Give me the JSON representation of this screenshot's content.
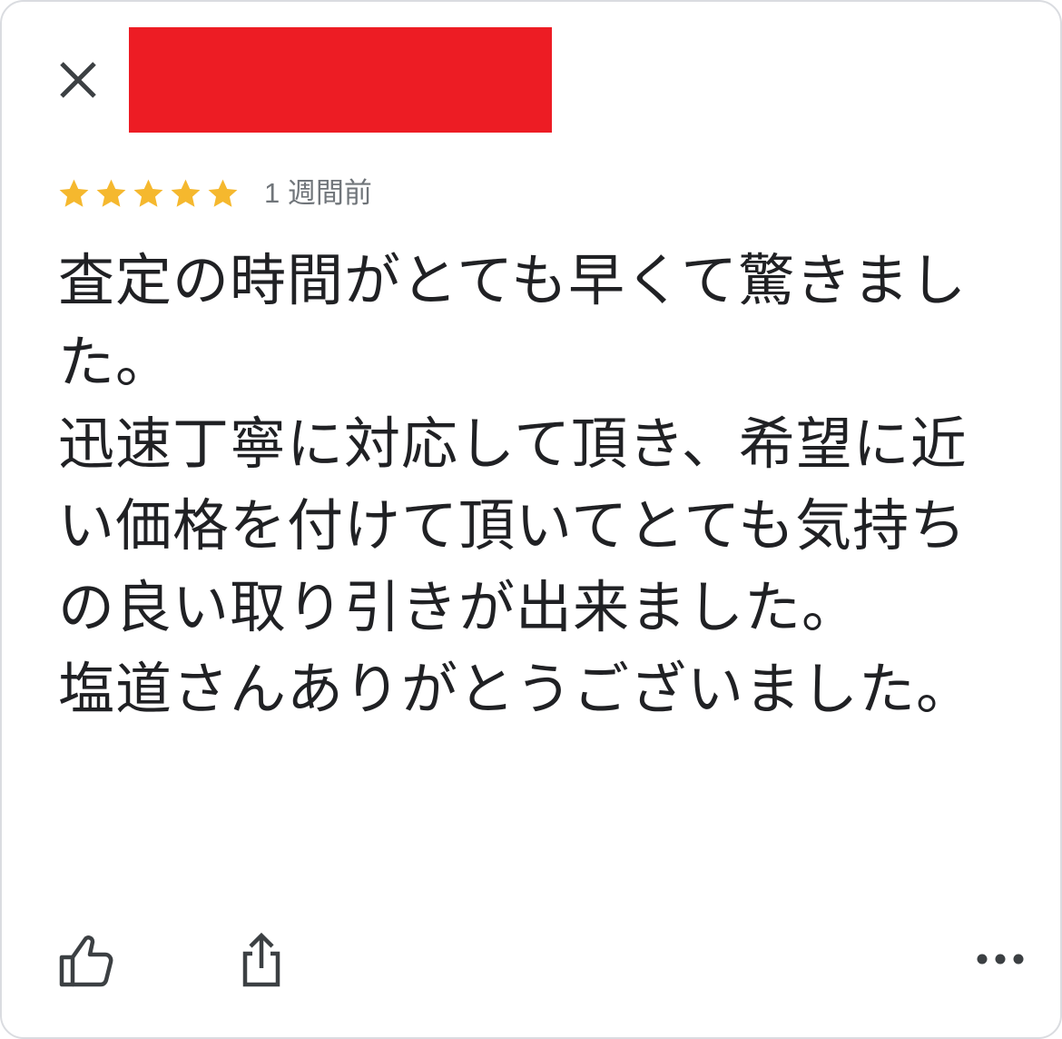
{
  "header": {
    "close_icon": "close-icon",
    "redaction_color": "#ed1c24"
  },
  "review": {
    "rating": 5,
    "rating_max": 5,
    "star_color": "#f5b82e",
    "relative_time": "1 週間前",
    "text": "査定の時間がとても早くて驚きました。\n迅速丁寧に対応して頂き、希望に近い価格を付けて頂いてとても気持ちの良い取り引きが出来ました。\n塩道さんありがとうございました。"
  },
  "actions": {
    "like_icon": "thumbs-up-icon",
    "share_icon": "share-icon",
    "more_icon": "more-options-icon"
  }
}
